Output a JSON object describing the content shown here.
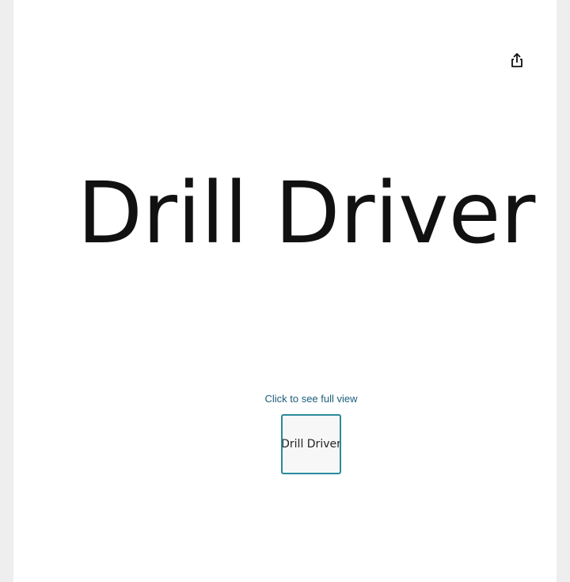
{
  "product_image": {
    "text": "Drill Driver"
  },
  "share": {
    "icon": "share-icon"
  },
  "gallery": {
    "full_view_label": "Click to see full view",
    "thumbnails": [
      {
        "text": "Drill Driver"
      }
    ],
    "selected_border_color": "#2a8a9a"
  },
  "colors": {
    "link": "#1b5e7b",
    "background": "#eeeeee"
  }
}
